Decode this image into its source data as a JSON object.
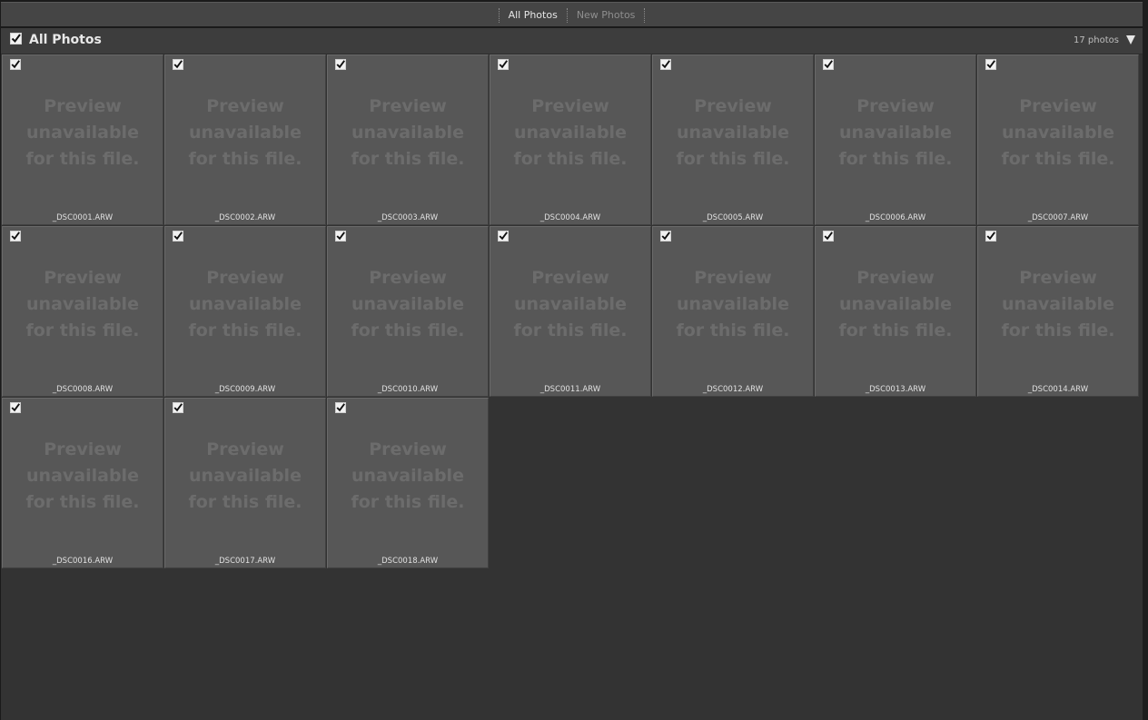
{
  "tabs": [
    {
      "label": "All Photos",
      "active": true
    },
    {
      "label": "New Photos",
      "active": false
    }
  ],
  "header": {
    "title": "All Photos",
    "count": "17 photos",
    "checked": true
  },
  "placeholder": {
    "line1": "Preview",
    "line2": "unavailable",
    "line3": "for this file."
  },
  "photos": [
    {
      "filename": "_DSC0001.ARW",
      "checked": true
    },
    {
      "filename": "_DSC0002.ARW",
      "checked": true
    },
    {
      "filename": "_DSC0003.ARW",
      "checked": true
    },
    {
      "filename": "_DSC0004.ARW",
      "checked": true
    },
    {
      "filename": "_DSC0005.ARW",
      "checked": true
    },
    {
      "filename": "_DSC0006.ARW",
      "checked": true
    },
    {
      "filename": "_DSC0007.ARW",
      "checked": true
    },
    {
      "filename": "_DSC0008.ARW",
      "checked": true
    },
    {
      "filename": "_DSC0009.ARW",
      "checked": true
    },
    {
      "filename": "_DSC0010.ARW",
      "checked": true
    },
    {
      "filename": "_DSC0011.ARW",
      "checked": true
    },
    {
      "filename": "_DSC0012.ARW",
      "checked": true
    },
    {
      "filename": "_DSC0013.ARW",
      "checked": true
    },
    {
      "filename": "_DSC0014.ARW",
      "checked": true
    },
    {
      "filename": "_DSC0016.ARW",
      "checked": true
    },
    {
      "filename": "_DSC0017.ARW",
      "checked": true
    },
    {
      "filename": "_DSC0018.ARW",
      "checked": true
    }
  ],
  "colors": {
    "tile_bg": "#575757",
    "placeholder_text": "#6c6c6c",
    "grid_bg": "#333333"
  },
  "icons": {
    "checkbox": "checkbox-checked-icon",
    "menu": "triangle-down-icon"
  }
}
